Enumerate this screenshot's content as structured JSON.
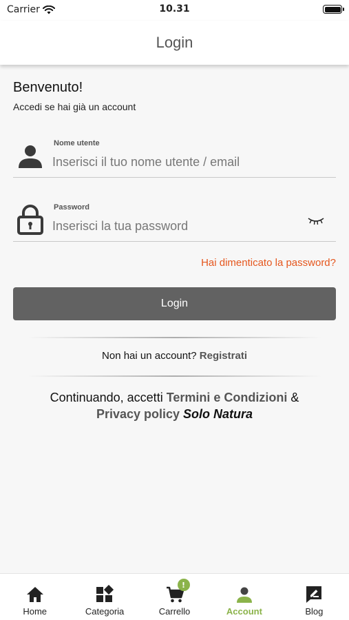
{
  "status_bar": {
    "carrier": "Carrier",
    "time": "10.31"
  },
  "header": {
    "title": "Login"
  },
  "welcome": {
    "title": "Benvenuto!",
    "subtitle": "Accedi se hai già un account"
  },
  "username_field": {
    "label": "Nome utente",
    "placeholder": "Inserisci il tuo nome utente / email",
    "value": ""
  },
  "password_field": {
    "label": "Password",
    "placeholder": "Inserisci la tua password",
    "value": ""
  },
  "forgot_password": "Hai dimenticato la password?",
  "login_button": "Login",
  "signup": {
    "prompt": "Non hai un account?",
    "link": "Registrati"
  },
  "terms": {
    "prefix": "Continuando, accetti",
    "terms_link": "Termini e Condizioni",
    "ampersand": "&",
    "privacy_link": "Privacy policy",
    "brand": "Solo Natura"
  },
  "tabs": [
    {
      "label": "Home",
      "icon": "home-icon"
    },
    {
      "label": "Categoria",
      "icon": "category-icon"
    },
    {
      "label": "Carrello",
      "icon": "cart-icon",
      "badge": "!"
    },
    {
      "label": "Account",
      "icon": "account-icon",
      "active": true
    },
    {
      "label": "Blog",
      "icon": "blog-icon"
    }
  ],
  "colors": {
    "accent_green": "#8bb34a",
    "link_orange": "#e5561d",
    "button_gray": "#626262"
  }
}
